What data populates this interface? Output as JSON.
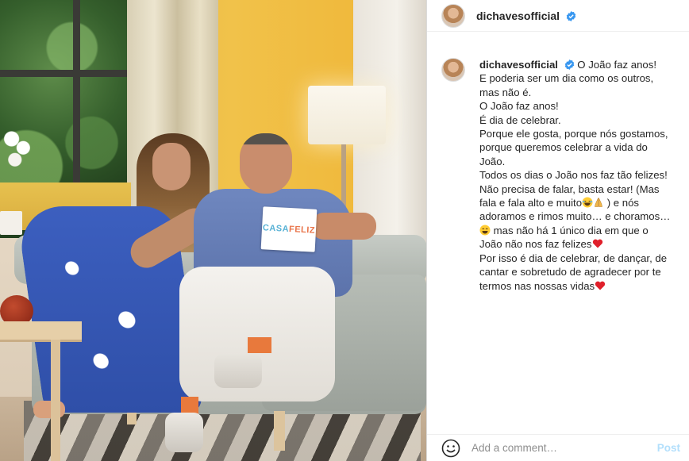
{
  "post": {
    "username": "dichavesofficial",
    "verified": true,
    "photo_card": {
      "word1": "CASA",
      "word2": "FELIZ"
    }
  },
  "caption": {
    "username": "dichavesofficial",
    "lines": [
      "O João faz anos!",
      "E poderia ser um dia como os outros,",
      "mas não é.",
      "O João faz anos!",
      "É dia de celebrar.",
      "Porque ele gosta, porque nós gostamos,",
      "porque queremos celebrar a vida do",
      "João.",
      "Todos os dias o João nos faz tão felizes!",
      "Não precisa de falar, basta estar! (Mas",
      "fala e fala alto e muito",
      ") e nós",
      "adoramos e rimos muito… e choramos…",
      "mas não há 1 único dia em que o",
      "João não nos faz felizes",
      "Por isso é dia de celebrar, de dançar, de",
      "cantar e sobretudo de agradecer por te",
      "termos nas nossas vidas"
    ],
    "icons": [
      "verified-badge-icon",
      "laughing-emoji-icon",
      "praying-hands-emoji-icon",
      "smiling-emoji-icon",
      "red-heart-emoji-icon"
    ]
  },
  "comment_box": {
    "placeholder": "Add a comment…",
    "post_label": "Post",
    "icon": "emoji-smile-icon"
  },
  "colors": {
    "verified_blue": "#3897f0",
    "post_disabled": "#b2dffc",
    "heart_red": "#e0202b"
  }
}
